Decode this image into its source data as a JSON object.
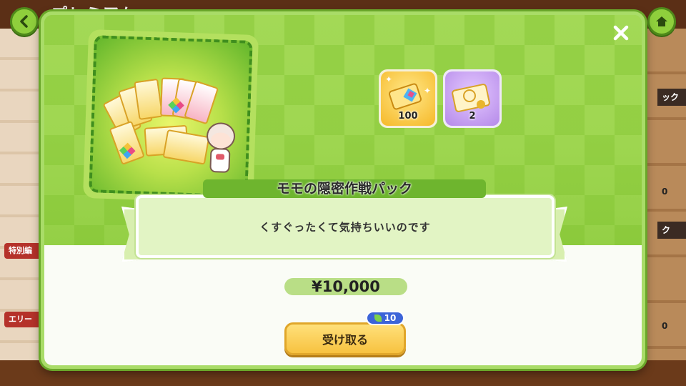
{
  "background": {
    "title": "プレミアム",
    "left_tags": [
      "特別編",
      "エリー"
    ],
    "right_tags": [
      "ック",
      "0",
      "ク",
      "0"
    ]
  },
  "modal": {
    "pack_name": "モモの隠密作戦パック",
    "description": "くすぐったくて気持ちいいのです",
    "price": "¥10,000",
    "receive_button": "受け取る",
    "badge_count": "10",
    "rewards": [
      {
        "icon": "gacha-ticket-icon",
        "count": "100"
      },
      {
        "icon": "gold-ticket-icon",
        "count": "2"
      }
    ]
  },
  "colors": {
    "modal_green": "#8fd044",
    "button_yellow": "#f7c240",
    "badge_blue": "#3c64d8"
  }
}
